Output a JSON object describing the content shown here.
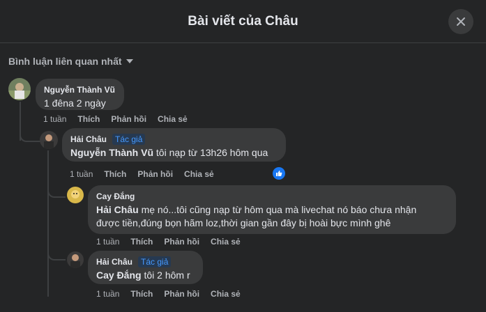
{
  "header": {
    "title": "Bài viết của Châu"
  },
  "sort": {
    "label": "Bình luận liên quan nhất"
  },
  "actions": {
    "like": "Thích",
    "reply": "Phản hồi",
    "share": "Chia sẻ"
  },
  "comments": [
    {
      "author": "Nguyễn Thành Vũ",
      "badge": "",
      "mention": "",
      "text": "1 đêna 2 ngày",
      "time": "1 tuần"
    },
    {
      "author": "Hải Châu",
      "badge": "Tác giả",
      "mention": "Nguyễn Thành Vũ",
      "text": " tôi nạp từ 13h26 hôm qua",
      "time": "1 tuần",
      "reaction": "like"
    },
    {
      "author": "Cay Đắng",
      "badge": "",
      "mention": "Hải Châu",
      "text": " mẹ nó...tôi cũng nạp từ hôm qua mà livechat nó báo chưa nhận",
      "text2": "được tiền,đúng bọn hãm loz,thời gian gần đây bị hoài bực mình ghê",
      "time": "1 tuần"
    },
    {
      "author": "Hải Châu",
      "badge": "Tác giả",
      "mention": "Cay Đắng",
      "text": " tôi 2 hôm r",
      "time": "1 tuần"
    }
  ],
  "colors": {
    "background": "#242526",
    "bubble": "#3a3b3c",
    "accent": "#4599ff",
    "text": "#e4e6eb",
    "muted": "#b0b3b8"
  }
}
